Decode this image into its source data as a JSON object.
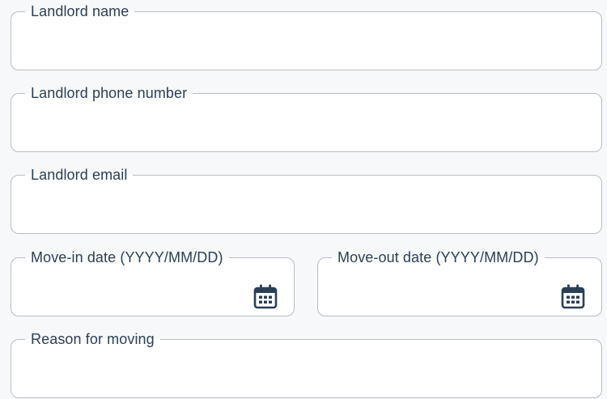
{
  "form": {
    "landlord_name": {
      "label": "Landlord name",
      "value": ""
    },
    "landlord_phone": {
      "label": "Landlord phone number",
      "value": ""
    },
    "landlord_email": {
      "label": "Landlord email",
      "value": ""
    },
    "move_in": {
      "label": "Move-in date (YYYY/MM/DD)",
      "value": "",
      "icon": "calendar-icon"
    },
    "move_out": {
      "label": "Move-out date (YYYY/MM/DD)",
      "value": "",
      "icon": "calendar-icon"
    },
    "reason": {
      "label": "Reason for moving",
      "value": ""
    }
  },
  "colors": {
    "label": "#2b3f55",
    "border": "#b9bcc2",
    "icon": "#2b3f55",
    "background": "#f7f8fa"
  }
}
